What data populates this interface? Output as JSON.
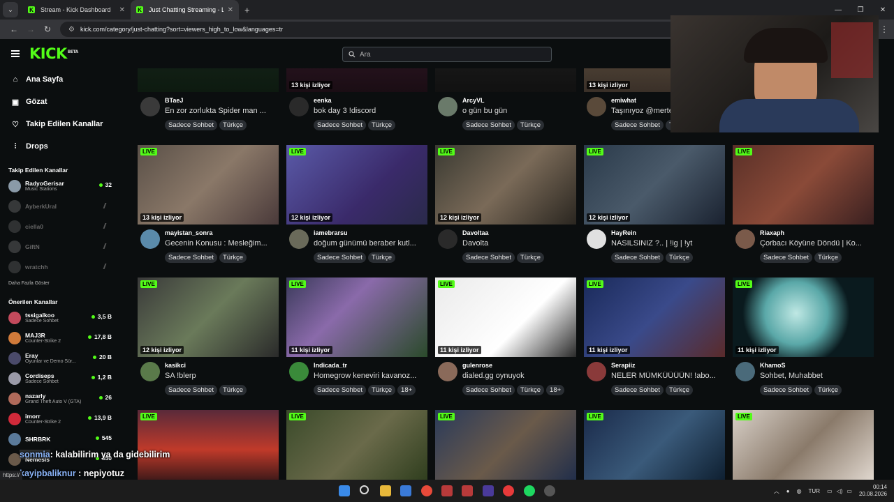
{
  "browser": {
    "tabs": [
      {
        "title": "Stream - Kick Dashboard",
        "active": false
      },
      {
        "title": "Just Chatting Streaming - Live S",
        "active": true
      }
    ],
    "url": "kick.com/category/just-chatting?sort=viewers_high_to_low&languages=tr",
    "status_url": "https://"
  },
  "header": {
    "logo": "KICK",
    "beta": "BETA",
    "search_placeholder": "Ara"
  },
  "sidebar": {
    "nav": [
      {
        "label": "Ana Sayfa",
        "icon": "home-icon"
      },
      {
        "label": "Gözat",
        "icon": "browse-icon"
      },
      {
        "label": "Takip Edilen Kanallar",
        "icon": "heart-icon"
      },
      {
        "label": "Drops",
        "icon": "drops-icon"
      }
    ],
    "followed_heading": "Takip Edilen Kanallar",
    "followed": [
      {
        "name": "RadyoGerisar",
        "category": "Music Stations",
        "viewers": "32",
        "live": true,
        "color": "#8a9aa8"
      },
      {
        "name": "AyberkUral",
        "category": "",
        "viewers": "",
        "live": false,
        "color": "#777"
      },
      {
        "name": "ciella0",
        "category": "",
        "viewers": "",
        "live": false,
        "color": "#666"
      },
      {
        "name": "GiftN",
        "category": "",
        "viewers": "",
        "live": false,
        "color": "#777"
      },
      {
        "name": "wratchh",
        "category": "",
        "viewers": "",
        "live": false,
        "color": "#666"
      }
    ],
    "show_more": "Daha Fazla Göster",
    "recommended_heading": "Önerilen Kanallar",
    "recommended": [
      {
        "name": "tssigalkoo",
        "category": "Sadece Sohbet",
        "viewers": "3,5 B",
        "color": "#c34a5c"
      },
      {
        "name": "MAJ3R",
        "category": "Counter-Strike 2",
        "viewers": "17,8 B",
        "color": "#d07a3a"
      },
      {
        "name": "Eray",
        "category": "Oyunlar ve Demo Sür...",
        "viewers": "20 B",
        "color": "#4a4a6a"
      },
      {
        "name": "Cordiseps",
        "category": "Sadece Sohbet",
        "viewers": "1,2 B",
        "color": "#9a9aa8"
      },
      {
        "name": "nazarly",
        "category": "Grand Theft Auto V (GTA)",
        "viewers": "26",
        "color": "#b06a5a"
      },
      {
        "name": "imorr",
        "category": "Counter-Strike 2",
        "viewers": "13,9 B",
        "color": "#d02a3a"
      },
      {
        "name": "SHRBRK",
        "category": "",
        "viewers": "545",
        "color": "#5a7a9a"
      },
      {
        "name": "Nemesls",
        "category": "",
        "viewers": "350",
        "color": "#6a5a4a"
      }
    ]
  },
  "tags": {
    "chat": "Sadece Sohbet",
    "lang": "Türkçe",
    "adult": "18+"
  },
  "cards": [
    {
      "channel": "BTaeJ",
      "title": "En zor zorlukta Spider man ...",
      "viewers": "",
      "adult": false,
      "thumb": "linear-gradient(180deg,#1b2a1e,#0d1a10)",
      "avatar": "#3a3a3a"
    },
    {
      "channel": "eenka",
      "title": "bok day 3 !discord",
      "viewers": "13 kişi izliyor",
      "adult": false,
      "thumb": "linear-gradient(180deg,#3a1c2c,#1a0d14)",
      "avatar": "#2a2a2a"
    },
    {
      "channel": "ArcyVL",
      "title": "o gün bu gün",
      "viewers": "",
      "adult": false,
      "thumb": "linear-gradient(180deg,#222,#111)",
      "avatar": "#6a7a6a"
    },
    {
      "channel": "emiwhat",
      "title": "Taşınıyoz @merte",
      "viewers": "13 kişi izliyor",
      "adult": false,
      "thumb": "linear-gradient(180deg,#6a5a48,#3a3028)",
      "avatar": "#5a4a3a"
    },
    {
      "channel": "mayistan_sonra",
      "title": "Gecenin Konusu : Mesleğim...",
      "viewers": "13 kişi izliyor",
      "adult": false,
      "thumb": "linear-gradient(135deg,#5a5048,#8a7868 50%,#4a3a3a)",
      "avatar": "#5a8aaa"
    },
    {
      "channel": "iamebrarsu",
      "title": "doğum günümü beraber kutl...",
      "viewers": "12 kişi izliyor",
      "adult": false,
      "thumb": "linear-gradient(135deg,#5a5aa8,#3a2a6a 60%,#2a2a4a)",
      "avatar": "#6a6a5a"
    },
    {
      "channel": "Davoltaa",
      "title": "Davolta",
      "viewers": "12 kişi izliyor",
      "adult": false,
      "thumb": "linear-gradient(135deg,#3a3a32,#7a6a58 50%,#2a2620)",
      "avatar": "#2a2a2a"
    },
    {
      "channel": "HayRein",
      "title": "NASILSINIZ ?.. | !ig | !yt",
      "viewers": "12 kişi izliyor",
      "adult": false,
      "thumb": "linear-gradient(135deg,#2a3a4a,#4a5a6a 50%,#1a2230)",
      "avatar": "#e0e0e0"
    },
    {
      "channel": "Riaxaph",
      "title": "Çorbacı Köyüne Döndü | Ko...",
      "viewers": "",
      "adult": false,
      "thumb": "linear-gradient(135deg,#5a3028,#8a4a38 50%,#3a2020)",
      "avatar": "#7a5a4a"
    },
    {
      "channel": "kasikci",
      "title": "SA !blerp",
      "viewers": "12 kişi izliyor",
      "adult": false,
      "thumb": "linear-gradient(135deg,#3a3a3a,#6a7a5a 50%,#2a2a2a)",
      "avatar": "#5a7a4a"
    },
    {
      "channel": "Indicada_tr",
      "title": "Homegrow keneviri kavanoz...",
      "viewers": "11 kişi izliyor",
      "adult": true,
      "thumb": "linear-gradient(135deg,#3a3a5a,#8a6aaa 40%,#2a4a2a)",
      "avatar": "#3a8a3a"
    },
    {
      "channel": "gulenrose",
      "title": "dialed.gg oynuyok",
      "viewers": "11 kişi izliyor",
      "adult": true,
      "thumb": "linear-gradient(135deg,#eaeaea,#ffffff 60%,#2a2a2a)",
      "avatar": "#8a6a5a"
    },
    {
      "channel": "Serapiiz",
      "title": "NELER MÜMKÜÜÜÜN! !abo...",
      "viewers": "11 kişi izliyor",
      "adult": false,
      "thumb": "linear-gradient(135deg,#1a2a5a,#3a4a8a 50%,#5a2a2a)",
      "avatar": "#8a3a3a"
    },
    {
      "channel": "KhamoS",
      "title": "Sohbet, Muhabbet",
      "viewers": "11 kişi izliyor",
      "adult": false,
      "thumb": "radial-gradient(circle at 45% 45%,#bfe8e4,#5aa8a8 35%,#0a1a1e 60%)",
      "avatar": "#4a6a7a"
    },
    {
      "channel": "",
      "title": "",
      "viewers": "",
      "adult": false,
      "thumb": "linear-gradient(180deg,#5a2a3a,#c03a2a 50%,#1a1014)",
      "avatar": ""
    },
    {
      "channel": "",
      "title": "",
      "viewers": "",
      "adult": false,
      "thumb": "linear-gradient(135deg,#3a4a2a,#6a6a4a 50%,#2a3a1a)",
      "avatar": ""
    },
    {
      "channel": "",
      "title": "",
      "viewers": "",
      "adult": false,
      "thumb": "linear-gradient(135deg,#2a3a5a,#6a5a4a 50%,#1a2a4a)",
      "avatar": ""
    },
    {
      "channel": "",
      "title": "",
      "viewers": "",
      "adult": false,
      "thumb": "linear-gradient(135deg,#1a2a4a,#3a5a7a 50%,#0a1a2a)",
      "avatar": ""
    },
    {
      "channel": "",
      "title": "",
      "viewers": "",
      "adult": false,
      "thumb": "linear-gradient(135deg,#d8d0c8,#8a7a6a 50%,#e8e0d8)",
      "avatar": ""
    }
  ],
  "chat_overlay": [
    {
      "user": "sonmia",
      "message": "kalabilirim ya da gidebilirim",
      "user_color": "#8ab4f8"
    },
    {
      "user": "kayipbaliknur",
      "message": "nepiyotuz",
      "user_color": "#8ab4f8"
    }
  ],
  "taskbar": {
    "language": "TUR",
    "time": "00:14",
    "date": "20.08.2026"
  }
}
